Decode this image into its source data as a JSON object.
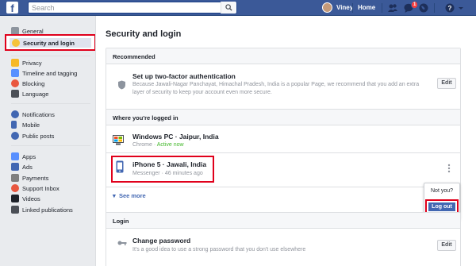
{
  "topbar": {
    "logo": "f",
    "search_placeholder": "Search",
    "user_name": "Viney",
    "home": "Home",
    "notification_count": "1"
  },
  "sidebar": {
    "items": [
      {
        "label": "General",
        "color": "#8d949e"
      },
      {
        "label": "Security and login",
        "color": "#f5c33b"
      },
      {
        "label": "Privacy",
        "color": "#f7b928"
      },
      {
        "label": "Timeline and tagging",
        "color": "#5890ff"
      },
      {
        "label": "Blocking",
        "color": "#e9573f"
      },
      {
        "label": "Language",
        "color": "#4b4f56"
      },
      {
        "label": "Notifications",
        "color": "#4267b2"
      },
      {
        "label": "Mobile",
        "color": "#4267b2"
      },
      {
        "label": "Public posts",
        "color": "#4267b2"
      },
      {
        "label": "Apps",
        "color": "#5890ff"
      },
      {
        "label": "Ads",
        "color": "#4267b2"
      },
      {
        "label": "Payments",
        "color": "#7f7f7f"
      },
      {
        "label": "Support Inbox",
        "color": "#e9573f"
      },
      {
        "label": "Videos",
        "color": "#1d2129"
      },
      {
        "label": "Linked publications",
        "color": "#4b4f56"
      }
    ]
  },
  "main": {
    "title": "Security and login",
    "recommended": {
      "header": "Recommended",
      "title": "Set up two-factor authentication",
      "desc_1": "Because Jawali-Nagar Panchayat, Himachal Pradesh, India is a popular Page, we recommend that you add an extra",
      "desc_2": "layer of security to keep your account even more secure.",
      "edit": "Edit"
    },
    "logged_in": {
      "header": "Where you're logged in",
      "sessions": [
        {
          "device": "Windows PC · Jaipur, India",
          "app": "Chrome",
          "status": "Active now"
        },
        {
          "device": "iPhone 5 · Jawali, India",
          "app": "Messenger",
          "status": "46 minutes ago"
        }
      ],
      "see_more": "See more",
      "menu": {
        "not_you": "Not you?",
        "logout": "Log out"
      }
    },
    "login": {
      "header": "Login",
      "title": "Change password",
      "desc": "It's a good idea to use a strong password that you don't use elsewhere",
      "edit": "Edit"
    }
  },
  "colors": {
    "brand": "#3b5998",
    "highlight": "#e0001b",
    "link": "#4267b2"
  }
}
